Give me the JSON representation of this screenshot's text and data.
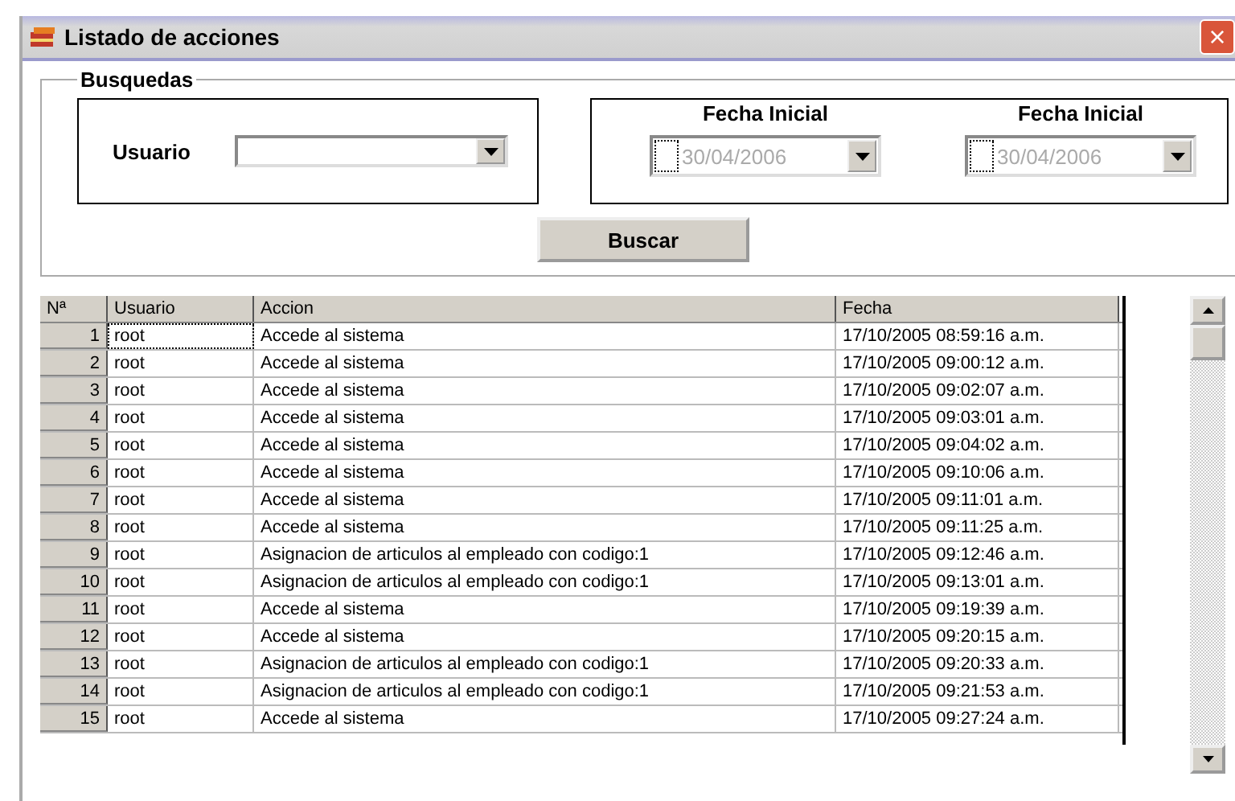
{
  "window": {
    "title": "Listado de acciones",
    "close": "×"
  },
  "search": {
    "title": "Busquedas",
    "user_label": "Usuario",
    "dates": [
      {
        "label": "Fecha Inicial",
        "value": "30/04/2006",
        "checked": false,
        "disabled": true
      },
      {
        "label": "Fecha Inicial",
        "value": "30/04/2006",
        "checked": false,
        "disabled": true
      }
    ],
    "button": "Buscar"
  },
  "table": {
    "columns": [
      "Nª",
      "Usuario",
      "Accion",
      "Fecha"
    ],
    "rows": [
      {
        "n": "1",
        "user": "root",
        "action": "Accede al sistema",
        "date": "17/10/2005 08:59:16 a.m.",
        "focused": true
      },
      {
        "n": "2",
        "user": "root",
        "action": "Accede al sistema",
        "date": "17/10/2005 09:00:12 a.m.",
        "focused": false
      },
      {
        "n": "3",
        "user": "root",
        "action": "Accede al sistema",
        "date": "17/10/2005 09:02:07 a.m.",
        "focused": false
      },
      {
        "n": "4",
        "user": "root",
        "action": "Accede al sistema",
        "date": "17/10/2005 09:03:01 a.m.",
        "focused": false
      },
      {
        "n": "5",
        "user": "root",
        "action": "Accede al sistema",
        "date": "17/10/2005 09:04:02 a.m.",
        "focused": false
      },
      {
        "n": "6",
        "user": "root",
        "action": "Accede al sistema",
        "date": "17/10/2005 09:10:06 a.m.",
        "focused": false
      },
      {
        "n": "7",
        "user": "root",
        "action": "Accede al sistema",
        "date": "17/10/2005 09:11:01 a.m.",
        "focused": false
      },
      {
        "n": "8",
        "user": "root",
        "action": "Accede al sistema",
        "date": "17/10/2005 09:11:25 a.m.",
        "focused": false
      },
      {
        "n": "9",
        "user": "root",
        "action": "Asignacion de articulos al empleado con codigo:1",
        "date": "17/10/2005 09:12:46 a.m.",
        "focused": false
      },
      {
        "n": "10",
        "user": "root",
        "action": "Asignacion de articulos al empleado con codigo:1",
        "date": "17/10/2005 09:13:01 a.m.",
        "focused": false
      },
      {
        "n": "11",
        "user": "root",
        "action": "Accede al sistema",
        "date": "17/10/2005 09:19:39 a.m.",
        "focused": false
      },
      {
        "n": "12",
        "user": "root",
        "action": "Accede al sistema",
        "date": "17/10/2005 09:20:15 a.m.",
        "focused": false
      },
      {
        "n": "13",
        "user": "root",
        "action": "Asignacion de articulos al empleado con codigo:1",
        "date": "17/10/2005 09:20:33 a.m.",
        "focused": false
      },
      {
        "n": "14",
        "user": "root",
        "action": "Asignacion de articulos al empleado con codigo:1",
        "date": "17/10/2005 09:21:53 a.m.",
        "focused": false
      },
      {
        "n": "15",
        "user": "root",
        "action": "Accede al sistema",
        "date": "17/10/2005 09:27:24 a.m.",
        "focused": false
      }
    ]
  }
}
